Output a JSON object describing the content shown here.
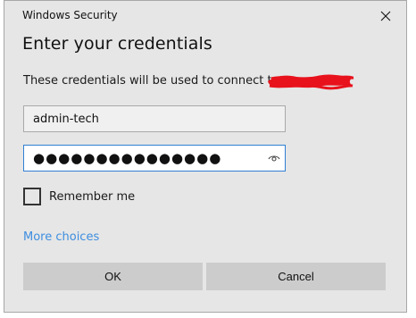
{
  "window": {
    "title": "Windows Security",
    "close_icon": "close-icon"
  },
  "dialog": {
    "heading": "Enter your credentials",
    "description": "These credentials will be used to connect to",
    "redaction_color": "#e8121c"
  },
  "username": {
    "value": "admin-tech"
  },
  "password": {
    "value": "●●●●●●●●●●●●●●●",
    "reveal_icon": "eye-icon"
  },
  "remember": {
    "label": "Remember me",
    "checked": false
  },
  "links": {
    "more_choices": "More choices"
  },
  "buttons": {
    "ok": "OK",
    "cancel": "Cancel"
  },
  "colors": {
    "accent": "#2f7fd4",
    "link": "#3d8ee0",
    "dialog_bg": "#e6e6e6",
    "button_bg": "#cccccc"
  }
}
